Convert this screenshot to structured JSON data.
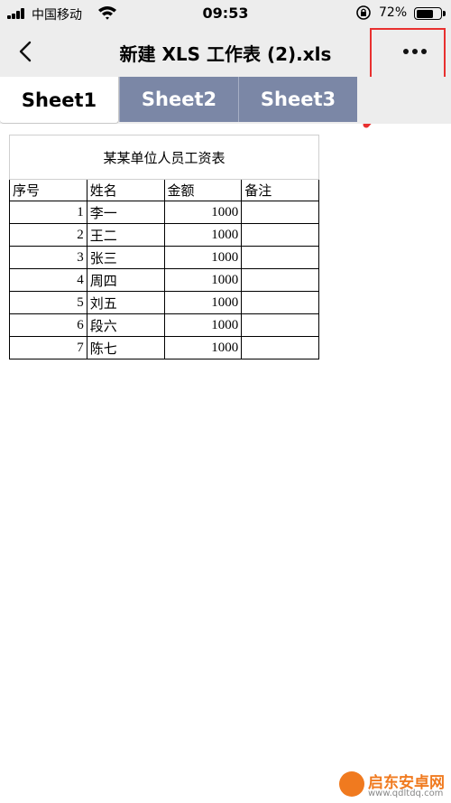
{
  "status_bar": {
    "carrier": "中国移动",
    "time": "09:53",
    "battery_percent": "72%",
    "battery_level": 0.72
  },
  "nav": {
    "title": "新建 XLS 工作表 (2).xls",
    "back_icon": "chevron-left-icon",
    "more_icon": "more-dots-icon"
  },
  "annotation": {
    "highlight_color": "#e8302f"
  },
  "tabs": [
    {
      "label": "Sheet1",
      "active": true
    },
    {
      "label": "Sheet2",
      "active": false
    },
    {
      "label": "Sheet3",
      "active": false
    }
  ],
  "sheet": {
    "title": "某某单位人员工资表",
    "columns": [
      "序号",
      "姓名",
      "金额",
      "备注"
    ],
    "rows": [
      {
        "no": "1",
        "name": "李一",
        "amount": "1000",
        "note": ""
      },
      {
        "no": "2",
        "name": "王二",
        "amount": "1000",
        "note": ""
      },
      {
        "no": "3",
        "name": "张三",
        "amount": "1000",
        "note": ""
      },
      {
        "no": "4",
        "name": "周四",
        "amount": "1000",
        "note": ""
      },
      {
        "no": "5",
        "name": "刘五",
        "amount": "1000",
        "note": ""
      },
      {
        "no": "6",
        "name": "段六",
        "amount": "1000",
        "note": ""
      },
      {
        "no": "7",
        "name": "陈七",
        "amount": "1000",
        "note": ""
      }
    ]
  },
  "watermark": {
    "name": "启东安卓网",
    "url": "www.qdltdq.com"
  },
  "colors": {
    "bar_background": "#ededed",
    "inactive_tab": "#7b87a6",
    "accent_red": "#e8302f",
    "watermark_orange": "#f07a1f"
  }
}
